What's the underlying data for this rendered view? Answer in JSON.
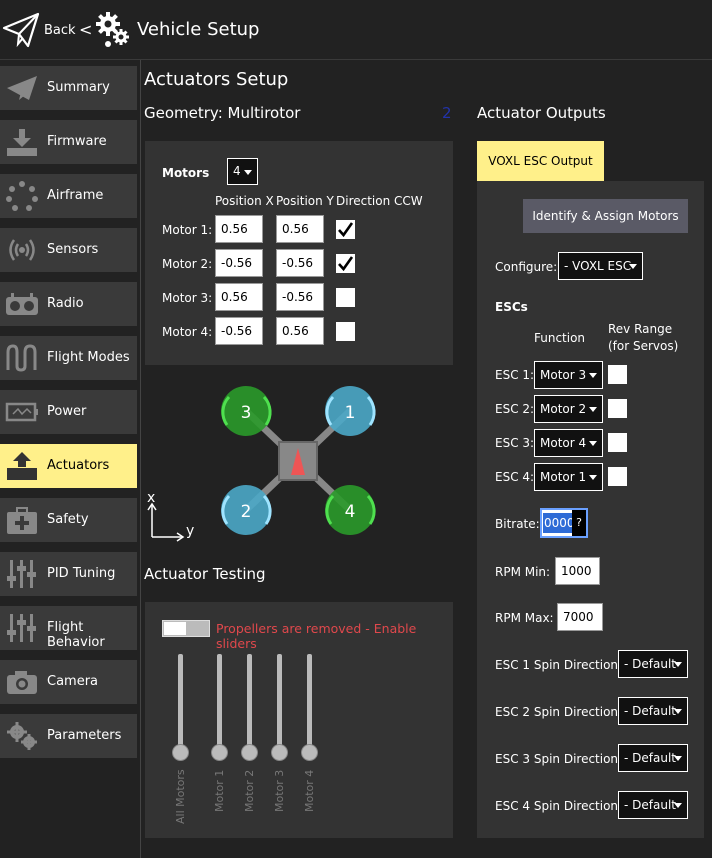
{
  "header": {
    "back_label": "Back",
    "separator": "<",
    "title": "Vehicle Setup"
  },
  "sidebar": {
    "items": [
      {
        "label": "Summary",
        "icon": "paper-plane-icon"
      },
      {
        "label": "Firmware",
        "icon": "download-icon"
      },
      {
        "label": "Airframe",
        "icon": "airframe-icon"
      },
      {
        "label": "Sensors",
        "icon": "sensors-icon"
      },
      {
        "label": "Radio",
        "icon": "radio-icon"
      },
      {
        "label": "Flight Modes",
        "icon": "flight-modes-icon"
      },
      {
        "label": "Power",
        "icon": "battery-icon"
      },
      {
        "label": "Actuators",
        "icon": "actuators-icon",
        "active": true
      },
      {
        "label": "Safety",
        "icon": "medkit-icon"
      },
      {
        "label": "PID Tuning",
        "icon": "sliders-icon"
      },
      {
        "label": "Flight Behavior",
        "icon": "sliders-icon"
      },
      {
        "label": "Camera",
        "icon": "camera-icon"
      },
      {
        "label": "Parameters",
        "icon": "gears-icon"
      }
    ]
  },
  "actuators": {
    "title": "Actuators Setup",
    "geometry": "Geometry: Multirotor",
    "geometry_badge": "2",
    "motors_label": "Motors",
    "motors_count": "4",
    "col_pos_x": "Position X",
    "col_pos_y": "Position Y",
    "col_dir": "Direction CCW",
    "motors": [
      {
        "label": "Motor 1:",
        "x": "0.56",
        "y": "0.56",
        "ccw": true
      },
      {
        "label": "Motor 2:",
        "x": "-0.56",
        "y": "-0.56",
        "ccw": true
      },
      {
        "label": "Motor 3:",
        "x": "0.56",
        "y": "-0.56",
        "ccw": false
      },
      {
        "label": "Motor 4:",
        "x": "-0.56",
        "y": "0.56",
        "ccw": false
      }
    ],
    "diagram": {
      "rotors": [
        "3",
        "1",
        "2",
        "4"
      ],
      "axis_x": "x",
      "axis_y": "y"
    }
  },
  "testing": {
    "title": "Actuator Testing",
    "warning": "Propellers are removed - Enable sliders",
    "sliders": [
      "All Motors",
      "Motor 1",
      "Motor 2",
      "Motor 3",
      "Motor 4"
    ]
  },
  "outputs": {
    "title": "Actuator Outputs",
    "tab": "VOXL ESC Output",
    "identify_button": "Identify & Assign Motors",
    "configure_label": "Configure:",
    "configure_value": "- VOXL ESC",
    "escs_title": "ESCs",
    "function_header": "Function",
    "rev_header_1": "Rev Range",
    "rev_header_2": "(for Servos)",
    "escs": [
      {
        "label": "ESC 1:",
        "function": "Motor 3"
      },
      {
        "label": "ESC 2:",
        "function": "Motor 2"
      },
      {
        "label": "ESC 3:",
        "function": "Motor 4"
      },
      {
        "label": "ESC 4:",
        "function": "Motor 1"
      }
    ],
    "bitrate_label": "Bitrate:",
    "bitrate_value": "0000",
    "bitrate_help": "?",
    "rpm_min_label": "RPM Min:",
    "rpm_min_value": "1000",
    "rpm_max_label": "RPM Max:",
    "rpm_max_value": "7000",
    "spin": [
      {
        "label": "ESC 1 Spin Direction:",
        "value": "- Default"
      },
      {
        "label": "ESC 2 Spin Direction:",
        "value": "- Default"
      },
      {
        "label": "ESC 3 Spin Direction:",
        "value": "- Default"
      },
      {
        "label": "ESC 4 Spin Direction:",
        "value": "- Default"
      }
    ]
  },
  "colors": {
    "accent": "#fff08a",
    "warning": "#e0484c",
    "rotor_cw": "#2a9a2a",
    "rotor_ccw": "#4ba8c8"
  }
}
